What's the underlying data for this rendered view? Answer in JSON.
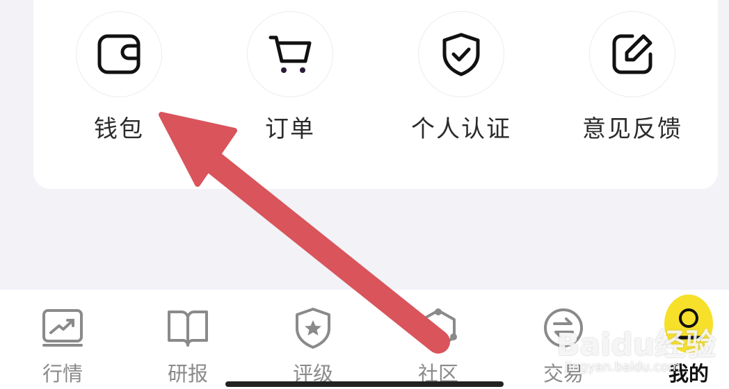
{
  "quick_actions": [
    {
      "label": "钱包",
      "icon": "wallet-icon"
    },
    {
      "label": "订单",
      "icon": "cart-icon"
    },
    {
      "label": "个人认证",
      "icon": "shield-check-icon"
    },
    {
      "label": "意见反馈",
      "icon": "edit-icon"
    }
  ],
  "tabs": [
    {
      "label": "行情",
      "icon": "trend-chart-icon"
    },
    {
      "label": "研报",
      "icon": "book-icon"
    },
    {
      "label": "评级",
      "icon": "star-badge-icon"
    },
    {
      "label": "社区",
      "icon": "community-icon"
    },
    {
      "label": "交易",
      "icon": "exchange-icon"
    },
    {
      "label": "我的",
      "icon": "profile-icon",
      "active": true
    }
  ],
  "watermark": {
    "logo": "Baidu经验",
    "url": "jingyan.baidu.com"
  },
  "colors": {
    "page_bg": "#f2f2f7",
    "card_bg": "#ffffff",
    "arrow": "#d9545b",
    "active_tab": "#f7e02a",
    "tab_inactive": "#8a8a8a"
  }
}
